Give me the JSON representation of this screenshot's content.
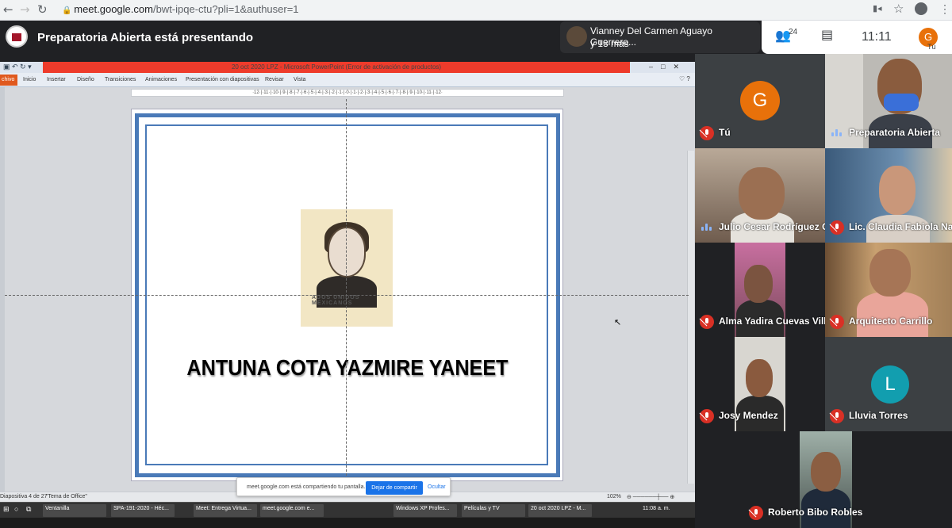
{
  "browser": {
    "url_host": "meet.google.com",
    "url_path": "/bwt-ipqe-ctu?pli=1&authuser=1"
  },
  "meet": {
    "presenting_text": "Preparatoria Abierta está presentando",
    "notification_line1": "Vianney Del Carmen Aguayo Guerrero...",
    "notification_line2": "y 13 más",
    "people_count": "24",
    "time": "11:11",
    "me_initial": "G",
    "me_label": "Tú"
  },
  "ppt": {
    "window_title": "20 oct 2020 LPZ  -  Microsoft PowerPoint (Error de activación de productos)",
    "ribbon_tabs": [
      "chivo",
      "Inicio",
      "Insertar",
      "Diseño",
      "Transiciones",
      "Animaciones",
      "Presentación con diapositivas",
      "Revisar",
      "Vista"
    ],
    "ruler_text": "·12·|·11·|·10·|·9·|·8·|·7·|·6·|·5·|·4·|·3·|·2·|·1·|·0·|·1·|·2·|·3·|·4·|·5·|·6·|·7·|·8·|·9·|·10·|·11·|·12·",
    "student_name": "ANTUNA COTA YAZMIRE YANEET",
    "photo_stamp": "ADOS UNIDOS MEXICANOS",
    "status_slide": "Diapositiva 4 de 27",
    "status_theme": "\"Tema de Office\"",
    "zoom": "102%"
  },
  "sharebar": {
    "message": "meet.google.com está compartiendo tu pantalla.",
    "stop_label": "Dejar de compartir",
    "hide_label": "Ocultar"
  },
  "taskbar": {
    "items": [
      "Ventanilla",
      "SPA-191-2020 - Héc...",
      "Meet: Entrega Virtua...",
      "meet.google.com e...",
      "Windows XP Profes...",
      "Películas y TV",
      "20 oct 2020 LPZ - M..."
    ],
    "clock": "11:08 a. m."
  },
  "participants": [
    {
      "name": "Tú",
      "initial": "G",
      "color": "#e8710a",
      "muted": true
    },
    {
      "name": "Preparatoria Abierta",
      "muted": false
    },
    {
      "name": "Julio Cesar Rodríguez O...",
      "muted": false
    },
    {
      "name": "Lic. Claudia Fabiola Nav...",
      "muted": true
    },
    {
      "name": "Alma Yadira Cuevas Vill...",
      "muted": true
    },
    {
      "name": "Arquitecto Carrillo",
      "muted": true
    },
    {
      "name": "Josy Mendez",
      "muted": true
    },
    {
      "name": "Lluvia Torres",
      "initial": "L",
      "color": "#129eaf",
      "muted": true
    },
    {
      "name": "Roberto Bibo Robles",
      "muted": true
    }
  ]
}
